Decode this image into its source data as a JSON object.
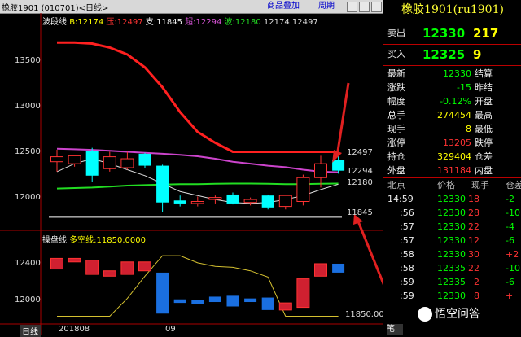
{
  "window": {
    "title": "橡胶1901 (010701)<日线>",
    "btn_overlay": "商品叠加",
    "btn_period": "周期"
  },
  "legend": {
    "name": "波段线",
    "b": "B:12174",
    "ya": "压:12497",
    "zhi": "支:11845",
    "chao": "超:12294",
    "bo": "波:12180",
    "v1": "12174",
    "v2": "12497"
  },
  "y_ticks": [
    "13500",
    "13000",
    "12500",
    "12000"
  ],
  "line_labels": {
    "l12497": "12497",
    "l12294": "12294",
    "l12180": "12180",
    "l11845": "11845"
  },
  "sub": {
    "name": "操盘线",
    "label": "多空线:11850.0000",
    "y_ticks": [
      "12400",
      "12000"
    ],
    "last": "11850.00"
  },
  "xaxis": {
    "tab": "日线",
    "d1": "201808",
    "d2": "09"
  },
  "colors": {
    "up": "#ff3333",
    "down": "#00ffff",
    "line_red": "#ff2020",
    "purple": "#cc44cc",
    "green": "#22dd22",
    "accent": "#ffff00"
  },
  "chart_data": {
    "type": "candlestick",
    "main": {
      "ylim": [
        11750,
        13750
      ],
      "y_ticks": [
        12000,
        12500,
        13000,
        13500
      ],
      "candles": [
        {
          "o": 12400,
          "h": 12520,
          "l": 12300,
          "c": 12450
        },
        {
          "o": 12380,
          "h": 12470,
          "l": 12350,
          "c": 12460
        },
        {
          "o": 12510,
          "h": 12540,
          "l": 12200,
          "c": 12260
        },
        {
          "o": 12330,
          "h": 12500,
          "l": 12300,
          "c": 12450
        },
        {
          "o": 12340,
          "h": 12500,
          "l": 12320,
          "c": 12430
        },
        {
          "o": 12480,
          "h": 12490,
          "l": 12340,
          "c": 12360
        },
        {
          "o": 12360,
          "h": 12370,
          "l": 11890,
          "c": 11990
        },
        {
          "o": 12010,
          "h": 12060,
          "l": 11950,
          "c": 11980
        },
        {
          "o": 11980,
          "h": 12050,
          "l": 11950,
          "c": 12000
        },
        {
          "o": 12020,
          "h": 12060,
          "l": 11980,
          "c": 12040
        },
        {
          "o": 12070,
          "h": 12090,
          "l": 11970,
          "c": 11980
        },
        {
          "o": 11990,
          "h": 12040,
          "l": 11960,
          "c": 12020
        },
        {
          "o": 12060,
          "h": 12070,
          "l": 11920,
          "c": 11940
        },
        {
          "o": 11950,
          "h": 12060,
          "l": 11920,
          "c": 12060
        },
        {
          "o": 12000,
          "h": 12270,
          "l": 11960,
          "c": 12240
        },
        {
          "o": 12240,
          "h": 12460,
          "l": 12140,
          "c": 12380
        },
        {
          "o": 12420,
          "h": 12460,
          "l": 12280,
          "c": 12310
        }
      ],
      "lines": {
        "resistance_red": [
          13600,
          13600,
          13590,
          13550,
          13480,
          13350,
          13150,
          12900,
          12700,
          12590,
          12500,
          12500,
          12500,
          12500,
          12500,
          12500,
          12500
        ],
        "purple": [
          12530,
          12525,
          12520,
          12510,
          12500,
          12490,
          12480,
          12470,
          12455,
          12430,
          12400,
          12380,
          12360,
          12345,
          12320,
          12300,
          12294
        ],
        "green": [
          12130,
          12135,
          12140,
          12150,
          12160,
          12165,
          12170,
          12175,
          12175,
          12178,
          12180,
          12180,
          12178,
          12175,
          12175,
          12178,
          12180
        ],
        "white_ma": [
          12300,
          12380,
          12430,
          12380,
          12320,
          12260,
          12180,
          12100,
          12060,
          12020,
          11990,
          11980,
          11990,
          12020,
          12060,
          12120,
          12174
        ],
        "support": [
          11845,
          11845,
          11845,
          11845,
          11845,
          11845,
          11845,
          11845,
          11845,
          11845,
          11845,
          11845,
          11845,
          11845,
          11845,
          11845,
          11845
        ]
      }
    },
    "sub": {
      "ylim": [
        11800,
        12650
      ],
      "y_ticks": [
        12000,
        12400
      ],
      "bars": [
        {
          "o": 12380,
          "c": 12500
        },
        {
          "o": 12460,
          "c": 12500
        },
        {
          "o": 12320,
          "c": 12480
        },
        {
          "o": 12300,
          "c": 12360
        },
        {
          "o": 12320,
          "c": 12460
        },
        {
          "o": 12360,
          "c": 12460
        },
        {
          "o": 12340,
          "c": 11880
        },
        {
          "o": 12040,
          "c": 12000
        },
        {
          "o": 12030,
          "c": 11990
        },
        {
          "o": 12070,
          "c": 12010
        },
        {
          "o": 12080,
          "c": 11960
        },
        {
          "o": 12050,
          "c": 12010
        },
        {
          "o": 12060,
          "c": 11920
        },
        {
          "o": 11920,
          "c": 12000
        },
        {
          "o": 11950,
          "c": 12270
        },
        {
          "o": 12300,
          "c": 12440
        },
        {
          "o": 12440,
          "c": 12340
        }
      ],
      "line": [
        11850,
        11850,
        11850,
        11850,
        12050,
        12300,
        12530,
        12530,
        12450,
        12410,
        12400,
        12360,
        12290,
        11850,
        11850,
        11850,
        11850
      ]
    }
  },
  "panel": {
    "title": "橡胶1901(ru1901)",
    "sell": {
      "label": "卖出",
      "price": "12330",
      "qty": "217"
    },
    "buy": {
      "label": "买入",
      "price": "12325",
      "qty": "9"
    },
    "stats": [
      {
        "l": "最新",
        "v": "12330",
        "v_color": "grn",
        "l2": "结算"
      },
      {
        "l": "涨跌",
        "v": "-15",
        "v_color": "grn",
        "l2": "昨结"
      },
      {
        "l": "幅度",
        "v": "-0.12%",
        "v_color": "grn",
        "l2": "开盘"
      },
      {
        "l": "总手",
        "v": "274454",
        "v_color": "yel",
        "l2": "最高"
      },
      {
        "l": "现手",
        "v": "8",
        "v_color": "yel",
        "l2": "最低"
      },
      {
        "l": "涨停",
        "v": "13205",
        "v_color": "red",
        "l2": "跌停"
      },
      {
        "l": "持仓",
        "v": "329404",
        "v_color": "yel",
        "l2": "仓差"
      },
      {
        "l": "外盘",
        "v": "131184",
        "v_color": "red",
        "l2": "内盘"
      }
    ],
    "trade_header": [
      "北京",
      "价格",
      "现手",
      "仓差"
    ],
    "trades": [
      {
        "t": "14:59",
        "p": "12330",
        "q": "18",
        "d": "-2"
      },
      {
        "t": ":56",
        "p": "12330",
        "q": "28",
        "d": "-10"
      },
      {
        "t": ":57",
        "p": "12330",
        "q": "22",
        "d": "-4"
      },
      {
        "t": ":57",
        "p": "12330",
        "q": "12",
        "d": "-6"
      },
      {
        "t": ":58",
        "p": "12330",
        "q": "30",
        "d": "+2"
      },
      {
        "t": ":58",
        "p": "12335",
        "q": "22",
        "d": "-10"
      },
      {
        "t": ":59",
        "p": "12335",
        "q": "2",
        "d": "-6"
      },
      {
        "t": ":59",
        "p": "12330",
        "q": "8",
        "d": "+"
      }
    ],
    "watermark": "悟空问答",
    "bottom_tab": "笔"
  }
}
